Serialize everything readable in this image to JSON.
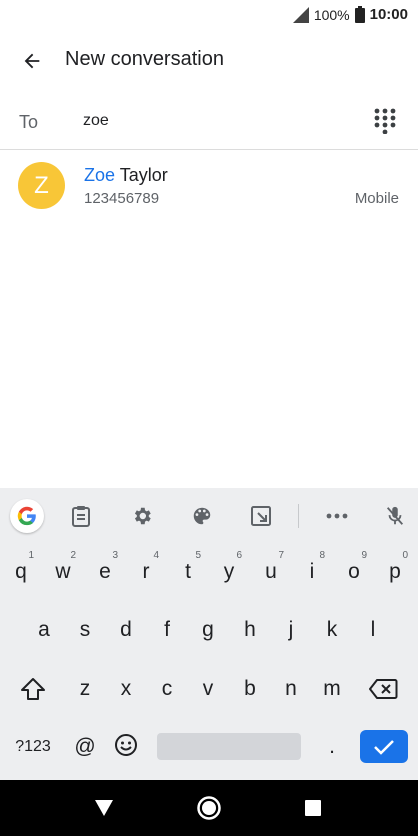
{
  "status_bar": {
    "battery": "100%",
    "time": "10:00"
  },
  "app_bar": {
    "title": "New conversation"
  },
  "to_field": {
    "label": "To",
    "value": "zoe"
  },
  "contact": {
    "avatar_letter": "Z",
    "avatar_color": "#f8c637",
    "name_match": "Zoe",
    "name_rest": " Taylor",
    "number": "123456789",
    "type": "Mobile"
  },
  "keyboard": {
    "row1": [
      {
        "key": "q",
        "hint": "1"
      },
      {
        "key": "w",
        "hint": "2"
      },
      {
        "key": "e",
        "hint": "3"
      },
      {
        "key": "r",
        "hint": "4"
      },
      {
        "key": "t",
        "hint": "5"
      },
      {
        "key": "y",
        "hint": "6"
      },
      {
        "key": "u",
        "hint": "7"
      },
      {
        "key": "i",
        "hint": "8"
      },
      {
        "key": "o",
        "hint": "9"
      },
      {
        "key": "p",
        "hint": "0"
      }
    ],
    "row2": [
      "a",
      "s",
      "d",
      "f",
      "g",
      "h",
      "j",
      "k",
      "l"
    ],
    "row3": [
      "z",
      "x",
      "c",
      "v",
      "b",
      "n",
      "m"
    ],
    "symbols_label": "?123",
    "at_label": "@",
    "period_label": ".",
    "accent_color": "#1a73e8"
  }
}
